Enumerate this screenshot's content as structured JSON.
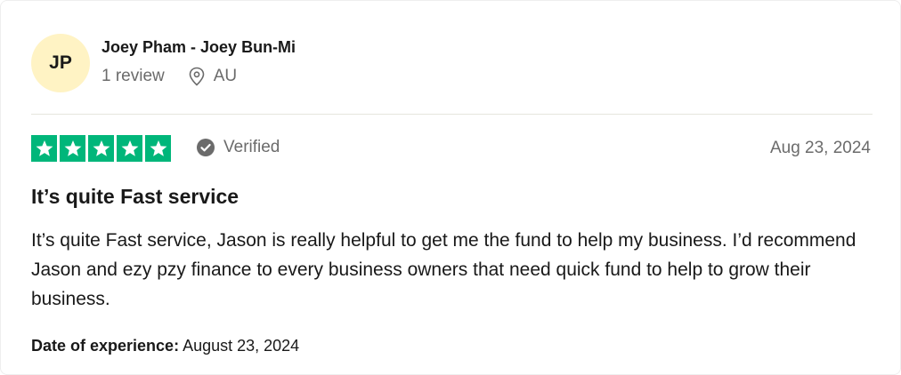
{
  "reviewer": {
    "initials": "JP",
    "name": "Joey Pham - Joey Bun-Mi",
    "review_count": "1 review",
    "location": "AU",
    "avatar_color": "#fff3c4"
  },
  "rating": {
    "stars": 5,
    "max_stars": 5,
    "star_color": "#00b67a",
    "verified_label": "Verified",
    "date": "Aug 23, 2024"
  },
  "review": {
    "title": "It’s quite Fast service",
    "body": "It’s quite Fast service, Jason is really helpful to get me the fund to help my business. I’d recommend Jason and ezy pzy finance to every business owners that need quick fund to help to grow their business.",
    "experience_label": "Date of experience:",
    "experience_date": "August 23, 2024"
  },
  "icons": {
    "location": "location-pin-icon",
    "verified": "check-circle-icon",
    "star": "star-icon"
  }
}
